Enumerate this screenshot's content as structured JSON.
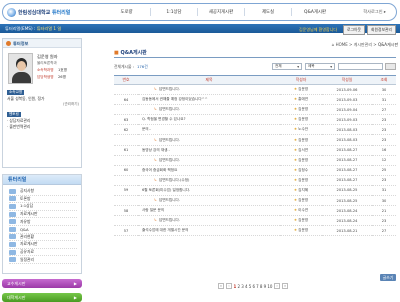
{
  "header": {
    "logo_main": "한림성심대학교",
    "logo_sub": "튜터리얼",
    "nav": [
      "도로량",
      "1:1상담",
      "새공지게시판",
      "제도실",
      "Q&A게시판"
    ],
    "home_link": "학사로그인 ▸"
  },
  "subbar": {
    "left_text": "튜터리얼(EMS) :",
    "left_highlight": "튜터리얼 1 일",
    "welcome": "김운영님께 환영합니다",
    "logout": "로그아웃",
    "mypage": "회원정보관리"
  },
  "profile": {
    "heading": "튜터정보",
    "name": "김운영 원자",
    "role": "물리토론학과",
    "rows": [
      {
        "label": "소속학과명",
        "value": "1호명"
      },
      {
        "label": "담당학생명",
        "value": "26명"
      }
    ],
    "section_title": "소속교명",
    "section_text": "서울 성북동, 인원, 정가",
    "section_link": "(관리하기)",
    "mentor_title": "멘토링",
    "mentor_items": [
      "· 상담자료관리",
      "· 출판번역관리"
    ]
  },
  "menu": {
    "heading": "튜터리얼",
    "items": [
      "공지사항",
      "토론방",
      "1:1상담",
      "자료게시판",
      "자유방",
      "Q&A",
      "관리현황",
      "자료게시판",
      "공유자료",
      "일정관리"
    ]
  },
  "side_buttons": [
    {
      "label": "교수게시판",
      "icon": "arrow-right-icon"
    },
    {
      "label": "대학게시판",
      "icon": "arrow-right-icon"
    }
  ],
  "main": {
    "breadcrumb": "HOME > 게시판관리 >",
    "breadcrumb_current": "Q&A게시판",
    "title": "Q&A게시판",
    "filter_label": "전체게시물 :",
    "filter_count": "176건",
    "select_a": "전체",
    "select_b": "제목",
    "columns": [
      "번호",
      "제목",
      "작성자",
      "작성일",
      "조회"
    ],
    "rows": [
      {
        "no": "",
        "title": "답변드립니다.",
        "author": "김운영",
        "date": "2013-09-06",
        "views": "30",
        "reply": true
      },
      {
        "no": "64",
        "title": "김동동에서 권해줄 예정 강정이었습니다^^",
        "author": "홍애연",
        "date": "2013-09-03",
        "views": "31",
        "reply": false
      },
      {
        "no": "",
        "title": "답변드립니다.",
        "author": "김운영",
        "date": "2013-09-04",
        "views": "27",
        "reply": true
      },
      {
        "no": "63",
        "title": "Q. 학점을 변경할 수 있나요?",
        "author": "김운영",
        "date": "2013-09-03",
        "views": "23",
        "reply": false
      },
      {
        "no": "62",
        "title": "문의..",
        "author": "노수안",
        "date": "2013-08-03",
        "views": "23",
        "reply": false
      },
      {
        "no": "",
        "title": "답변드립니다.",
        "author": "김운영",
        "date": "2013-08-03",
        "views": "23",
        "reply": true
      },
      {
        "no": "61",
        "title": "동영상 강의 재생..",
        "author": "김서연",
        "date": "2013-08-27",
        "views": "16",
        "reply": false
      },
      {
        "no": "",
        "title": "답변드립니다.",
        "author": "김운영",
        "date": "2013-08-27",
        "views": "12",
        "reply": true
      },
      {
        "no": "60",
        "title": "중국어 중급회화 책정요",
        "author": "김정수",
        "date": "2013-08-27",
        "views": "25",
        "reply": false
      },
      {
        "no": "",
        "title": "답변드립니다.(수정)",
        "author": "김운영",
        "date": "2013-08-27",
        "views": "23",
        "reply": true
      },
      {
        "no": "59",
        "title": "6월 토론회(미수업) 일정합니다.",
        "author": "김지혜",
        "date": "2013-08-25",
        "views": "31",
        "reply": false
      },
      {
        "no": "",
        "title": "답변드립니다.",
        "author": "김운영",
        "date": "2013-08-25",
        "views": "30",
        "reply": true
      },
      {
        "no": "58",
        "title": "사람 질문 문의",
        "author": "이수연",
        "date": "2013-08-24",
        "views": "21",
        "reply": false
      },
      {
        "no": "",
        "title": "답변드립니다.",
        "author": "김운영",
        "date": "2013-08-24",
        "views": "23",
        "reply": true
      },
      {
        "no": "57",
        "title": "출석수업에 대한 개별시간 문의",
        "author": "김운영",
        "date": "2013-08-21",
        "views": "27",
        "reply": false
      }
    ],
    "write_button": "글쓰기",
    "pager": {
      "pages": [
        "1",
        "2",
        "3",
        "4",
        "5",
        "6",
        "7",
        "8",
        "9",
        "10"
      ],
      "current": "1",
      "prev_first": "«",
      "prev": "‹",
      "next": "›",
      "next_last": "»"
    }
  },
  "colors": {
    "brand_blue": "#1b5a98",
    "accent_orange": "#e07a2b",
    "label_red": "#c0392b"
  }
}
